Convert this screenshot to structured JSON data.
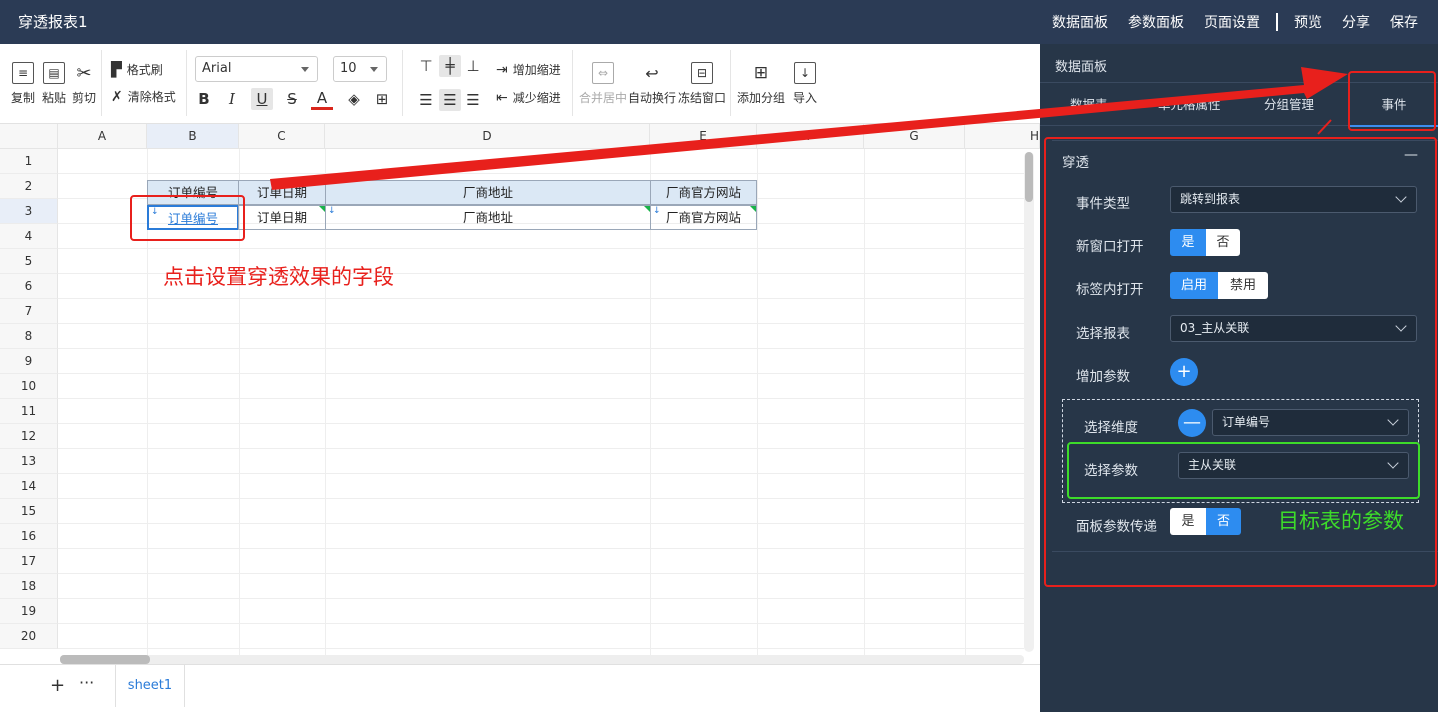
{
  "app": {
    "title": "穿透报表1",
    "nav": [
      "数据面板",
      "参数面板",
      "页面设置",
      "预览",
      "分享",
      "保存"
    ]
  },
  "toolbar": {
    "copy": "复制",
    "paste": "粘贴",
    "cut": "剪切",
    "format_painter": "格式刷",
    "clear_format": "清除格式",
    "font": "Arial",
    "font_size": "10",
    "bold": "B",
    "italic": "I",
    "underline": "U",
    "strike": "S",
    "font_color": "A",
    "indent_increase": "增加缩进",
    "indent_decrease": "减少缩进",
    "merge_center": "合并居中",
    "wrap_text": "自动换行",
    "freeze": "冻结窗口",
    "add_group": "添加分组",
    "import": "导入"
  },
  "sheet": {
    "columns": [
      "A",
      "B",
      "C",
      "D",
      "E",
      "F",
      "G",
      "H"
    ],
    "rows": [
      "1",
      "2",
      "3",
      "4",
      "5",
      "6",
      "7",
      "8",
      "9",
      "10",
      "11",
      "12",
      "13",
      "14",
      "15",
      "16",
      "17",
      "18",
      "19",
      "20"
    ],
    "header_row": [
      "订单编号",
      "订单日期",
      "厂商地址",
      "厂商官方网站"
    ],
    "data_row": [
      "订单编号",
      "订单日期",
      "厂商地址",
      "厂商官方网站"
    ]
  },
  "annotations": {
    "click_field_note": "点击设置穿透效果的字段",
    "target_param_note": "目标表的参数"
  },
  "tabs": {
    "sheet_name": "sheet1",
    "add": "+",
    "more": "···"
  },
  "panel": {
    "title": "数据面板",
    "tabs": [
      "数据表",
      "单元格属性",
      "分组管理",
      "事件"
    ],
    "section_title": "穿透",
    "collapse": "—",
    "event_type_label": "事件类型",
    "event_type_value": "跳转到报表",
    "new_window_label": "新窗口打开",
    "new_window_yes": "是",
    "new_window_no": "否",
    "tab_open_label": "标签内打开",
    "tab_open_enable": "启用",
    "tab_open_disable": "禁用",
    "report_label": "选择报表",
    "report_value": "03_主从关联",
    "add_param_label": "增加参数",
    "add_param_icon": "+",
    "dimension_label": "选择维度",
    "remove_icon": "—",
    "dimension_value": "订单编号",
    "param_label": "选择参数",
    "param_value": "主从关联",
    "pass_label": "面板参数传递",
    "pass_yes": "是",
    "pass_no": "否"
  },
  "colors": {
    "topbar": "#2b3b55",
    "panel": "#273648",
    "accent": "#2d8cf0",
    "annotation_red": "#e8201c",
    "annotation_green": "#3ddc2a"
  }
}
